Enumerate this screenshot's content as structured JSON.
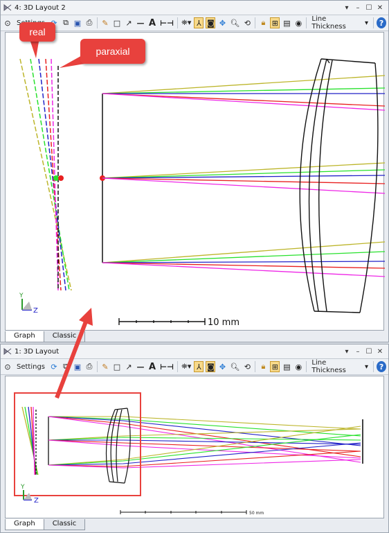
{
  "colors": {
    "yellow": "#bcb52a",
    "green": "#27e12c",
    "blue": "#2222c8",
    "red": "#e82020",
    "magenta": "#ee27e6",
    "black": "#111111",
    "annotation": "#e8413d"
  },
  "top_window": {
    "title": "4: 3D Layout 2",
    "toolbar": {
      "settings_label": "Settings",
      "line_thickness_label": "Line Thickness"
    },
    "axis": {
      "y": "Y",
      "z": "Z"
    },
    "scale_label": "10 mm",
    "tabs": [
      {
        "label": "Graph",
        "selected": true
      },
      {
        "label": "Classic",
        "selected": false
      }
    ]
  },
  "bottom_window": {
    "title": "1: 3D Layout",
    "toolbar": {
      "settings_label": "Settings",
      "line_thickness_label": "Line Thickness"
    },
    "axis": {
      "y": "Y",
      "z": "Z"
    },
    "scale_label": "50 mm",
    "tabs": [
      {
        "label": "Graph",
        "selected": true
      },
      {
        "label": "Classic",
        "selected": false
      }
    ]
  },
  "annotations": {
    "real": "real",
    "paraxial": "paraxial"
  }
}
